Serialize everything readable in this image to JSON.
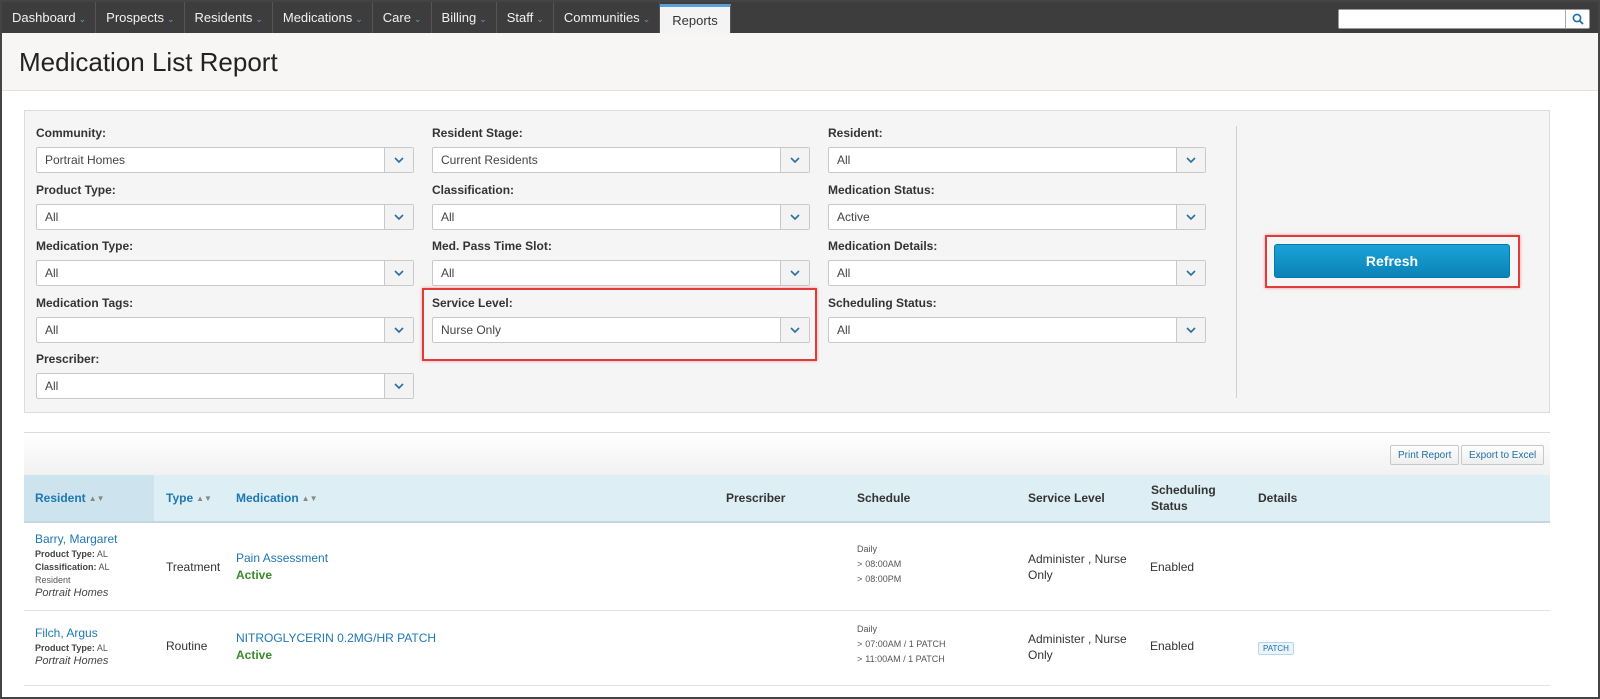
{
  "nav": {
    "items": [
      {
        "label": "Dashboard",
        "has_menu": true
      },
      {
        "label": "Prospects",
        "has_menu": true
      },
      {
        "label": "Residents",
        "has_menu": true
      },
      {
        "label": "Medications",
        "has_menu": true
      },
      {
        "label": "Care",
        "has_menu": true
      },
      {
        "label": "Billing",
        "has_menu": true
      },
      {
        "label": "Staff",
        "has_menu": true
      },
      {
        "label": "Communities",
        "has_menu": true
      },
      {
        "label": "Reports",
        "has_menu": false,
        "active": true
      }
    ],
    "search": {
      "value": "",
      "placeholder": ""
    }
  },
  "page": {
    "title": "Medication List Report"
  },
  "filters": {
    "community": {
      "label": "Community:",
      "value": "Portrait Homes"
    },
    "resident_stage": {
      "label": "Resident Stage:",
      "value": "Current Residents"
    },
    "resident": {
      "label": "Resident:",
      "value": "All"
    },
    "product_type": {
      "label": "Product Type:",
      "value": "All"
    },
    "classification": {
      "label": "Classification:",
      "value": "All"
    },
    "medication_status": {
      "label": "Medication Status:",
      "value": "Active"
    },
    "medication_type": {
      "label": "Medication Type:",
      "value": "All"
    },
    "med_pass_time_slot": {
      "label": "Med. Pass Time Slot:",
      "value": "All"
    },
    "medication_details": {
      "label": "Medication Details:",
      "value": "All"
    },
    "medication_tags": {
      "label": "Medication Tags:",
      "value": "All"
    },
    "service_level": {
      "label": "Service Level:",
      "value": "Nurse Only"
    },
    "scheduling_status": {
      "label": "Scheduling Status:",
      "value": "All"
    },
    "prescriber": {
      "label": "Prescriber:",
      "value": "All"
    },
    "refresh_label": "Refresh"
  },
  "toolbar": {
    "print_label": "Print Report",
    "export_label": "Export to Excel"
  },
  "table": {
    "headers": {
      "resident": "Resident",
      "type": "Type",
      "medication": "Medication",
      "prescriber": "Prescriber",
      "schedule": "Schedule",
      "service_level": "Service Level",
      "scheduling_status_1": "Scheduling",
      "scheduling_status_2": "Status",
      "details": "Details"
    },
    "rows": [
      {
        "resident": "Barry, Margaret",
        "product_type_label": "Product Type:",
        "product_type": "AL",
        "classification_label": "Classification:",
        "classification_1": "AL",
        "classification_2": "Resident",
        "community": "Portrait Homes",
        "type": "Treatment",
        "medication": "Pain Assessment",
        "status": "Active",
        "prescriber": "",
        "schedule_freq": "Daily",
        "schedule_times": [
          "08:00AM",
          "08:00PM"
        ],
        "service_level_1": "Administer , Nurse",
        "service_level_2": "Only",
        "scheduling_status": "Enabled",
        "details_tag": ""
      },
      {
        "resident": "Filch, Argus",
        "product_type_label": "Product Type:",
        "product_type": "AL",
        "community": "Portrait Homes",
        "type": "Routine",
        "medication": "NITROGLYCERIN 0.2MG/HR PATCH",
        "status": "Active",
        "prescriber": "",
        "schedule_freq": "Daily",
        "schedule_times": [
          "07:00AM / 1 PATCH",
          "11:00AM / 1 PATCH"
        ],
        "service_level_1": "Administer , Nurse",
        "service_level_2": "Only",
        "scheduling_status": "Enabled",
        "details_tag": "PATCH"
      }
    ]
  },
  "colors": {
    "accent": "#1d77b3",
    "highlight": "#e03b3b",
    "refresh": "#0a8fc6",
    "active_status": "#3a8a2a"
  }
}
